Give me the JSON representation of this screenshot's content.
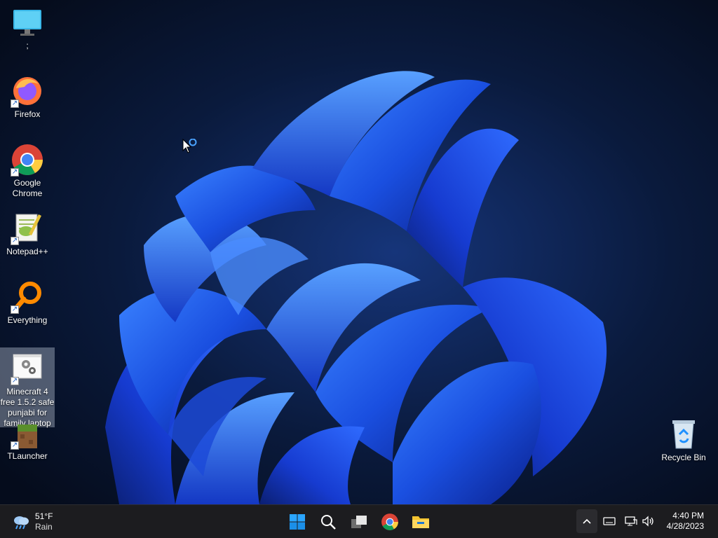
{
  "desktop": {
    "icons": [
      {
        "label": ";"
      },
      {
        "label": "Firefox"
      },
      {
        "label": "Google Chrome"
      },
      {
        "label": "Notepad++"
      },
      {
        "label": "Everything"
      },
      {
        "label": "Minecraft 4 free 1.5.2 safe punjabi for family laptop"
      },
      {
        "label": "TLauncher"
      },
      {
        "label": "Recycle Bin"
      }
    ]
  },
  "taskbar": {
    "weather": {
      "temp": "51°F",
      "condition": "Rain",
      "icon": "cloud-rain-icon"
    },
    "pinned": [
      {
        "name": "Start",
        "icon": "windows-start-icon"
      },
      {
        "name": "Search",
        "icon": "search-icon"
      },
      {
        "name": "Task View",
        "icon": "task-view-icon"
      },
      {
        "name": "Google Chrome",
        "icon": "chrome-icon"
      },
      {
        "name": "File Explorer",
        "icon": "folder-icon"
      }
    ],
    "tray": {
      "icons": [
        "chevron-up-icon",
        "keyboard-icon",
        "network-icon",
        "volume-icon"
      ]
    },
    "clock": {
      "time": "4:40 PM",
      "date": "4/28/2023"
    }
  },
  "colors": {
    "accent": "#0078d4",
    "taskbar": "#1c1c1f",
    "wallpaper_bloom": "#1a5cff"
  }
}
